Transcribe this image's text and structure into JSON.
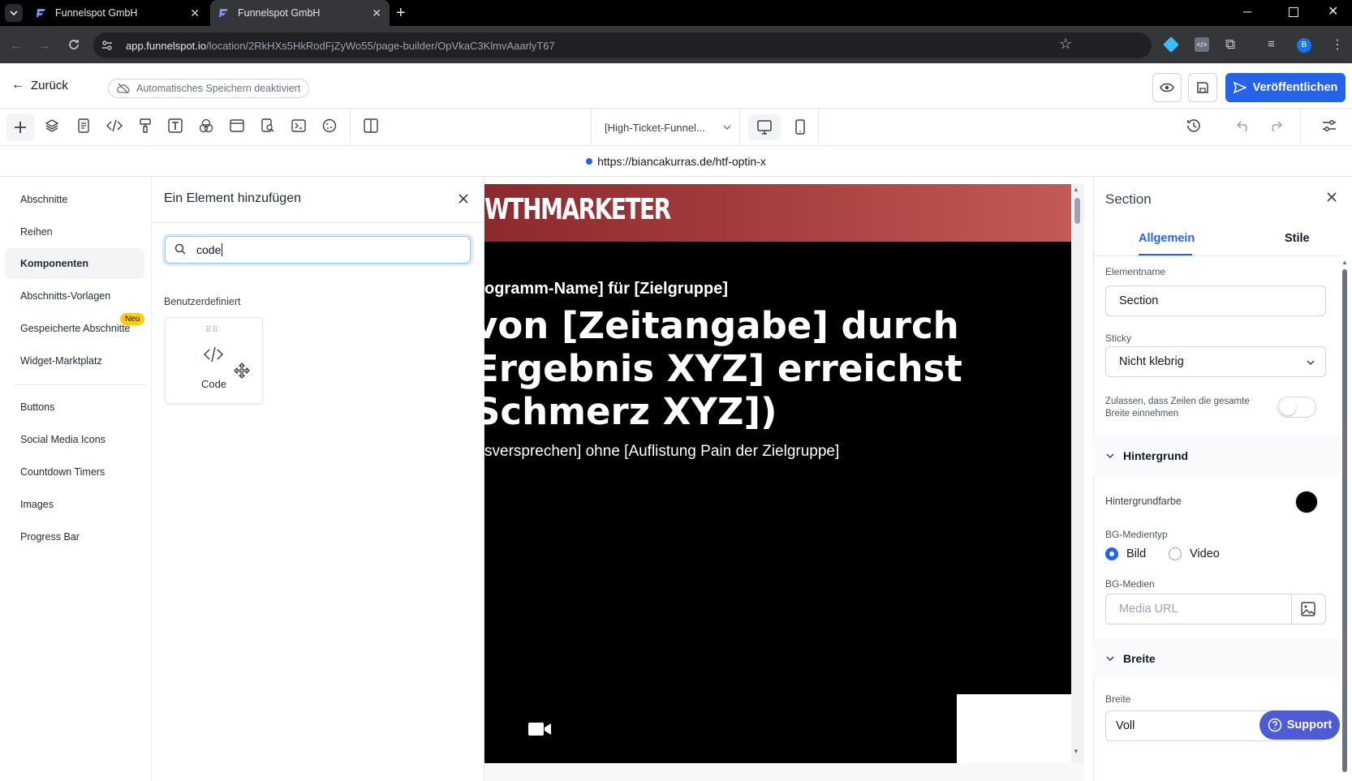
{
  "browser": {
    "tabs": [
      {
        "title": "Funnelspot GmbH",
        "active": false
      },
      {
        "title": "Funnelspot GmbH",
        "active": true
      }
    ],
    "url_host": "app.funnelspot.io",
    "url_path": "/location/2RkHXs5HkRodFjZyWo55/page-builder/OpVkaC3KlmvAaarlyT67",
    "profile_initial": "B"
  },
  "header": {
    "back_label": "Zurück",
    "autosave_label": "Automatisches Speichern deaktiviert",
    "publish_label": "Veröffentlichen"
  },
  "toolbar": {
    "page_select": "[High-Ticket-Funnel..."
  },
  "preview_url": "https://biancakurras.de/htf-optin-x",
  "left_nav": {
    "items": [
      "Abschnitte",
      "Reihen",
      "Komponenten",
      "Abschnitts-Vorlagen",
      "Gespeicherte Abschnitte",
      "Widget-Marktplatz"
    ],
    "badge_new": "Neu",
    "components": [
      "Buttons",
      "Social Media Icons",
      "Countdown Timers",
      "Images",
      "Progress Bar"
    ]
  },
  "add_panel": {
    "title": "Ein Element hinzufügen",
    "search_value": "code",
    "category": "Benutzerdefiniert",
    "card_label": "Code"
  },
  "canvas": {
    "logo": "WTHMARKETER",
    "subheadline": "ogramm-Name] für [Zielgruppe]",
    "headline_lines": [
      "von [Zeitangabe] durch",
      "Ergebnis XYZ] erreichst",
      "Schmerz XYZ])"
    ],
    "subline": "sversprechen] ohne [Auflistung Pain der Zielgruppe]"
  },
  "settings": {
    "title": "Section",
    "tab_general": "Allgemein",
    "tab_styles": "Stile",
    "element_name_label": "Elementname",
    "element_name_value": "Section",
    "sticky_label": "Sticky",
    "sticky_value": "Nicht klebrig",
    "fullwidth_label": "Zulassen, dass Zeilen die gesamte Breite einnehmen",
    "background_header": "Hintergrund",
    "bg_color_label": "Hintergrundfarbe",
    "bg_color": "#000000",
    "bg_media_type_label": "BG-Medientyp",
    "bg_media_type_options": [
      "Bild",
      "Video"
    ],
    "bg_media_type_selected": "Bild",
    "bg_media_label": "BG-Medien",
    "bg_media_placeholder": "Media URL",
    "width_header": "Breite",
    "width_label": "Breite",
    "width_value": "Voll"
  },
  "support_label": "Support",
  "colors": {
    "accent": "#2563eb",
    "support": "#4f5bd5",
    "badge": "#facc15"
  }
}
